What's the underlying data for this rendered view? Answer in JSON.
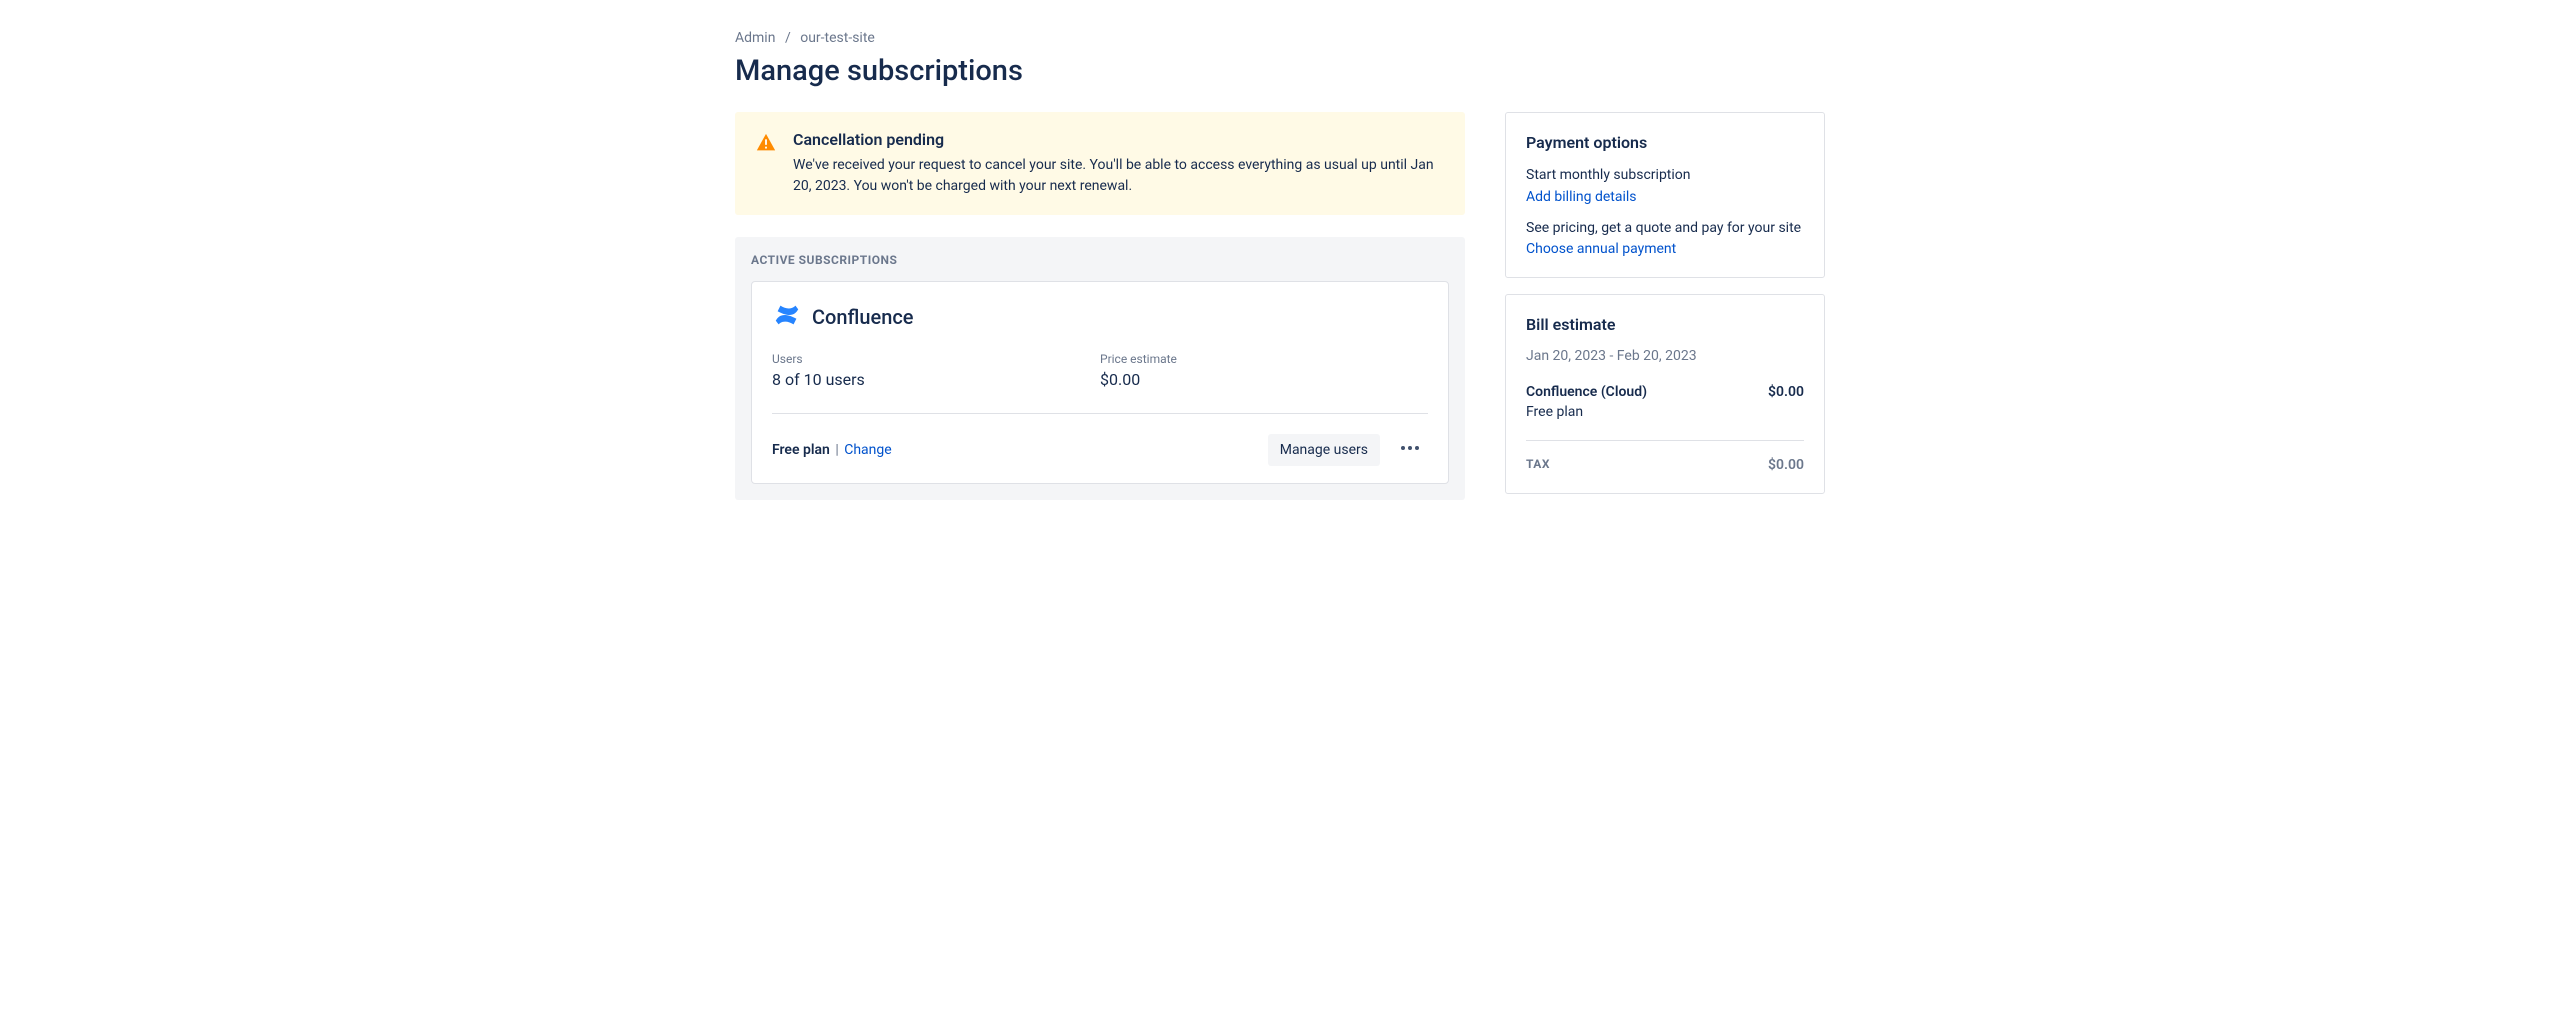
{
  "breadcrumb": {
    "admin": "Admin",
    "site": "our-test-site"
  },
  "page_title": "Manage subscriptions",
  "banner": {
    "title": "Cancellation pending",
    "body": "We've received your request to cancel your site. You'll be able to access everything as usual up until Jan 20, 2023. You won't be charged with your next renewal."
  },
  "active_subscriptions": {
    "header": "ACTIVE SUBSCRIPTIONS",
    "items": [
      {
        "name": "Confluence",
        "users_label": "Users",
        "users_value": "8 of 10 users",
        "price_label": "Price estimate",
        "price_value": "$0.00",
        "plan_name": "Free plan",
        "change_label": "Change",
        "manage_users_label": "Manage users"
      }
    ]
  },
  "payment_options": {
    "title": "Payment options",
    "monthly_text": "Start monthly subscription",
    "monthly_link": "Add billing details",
    "annual_text": "See pricing, get a quote and pay for your site",
    "annual_link": "Choose annual payment"
  },
  "bill_estimate": {
    "title": "Bill estimate",
    "period": "Jan 20, 2023 - Feb 20, 2023",
    "line_item_name": "Confluence (Cloud)",
    "line_item_value": "$0.00",
    "line_item_plan": "Free plan",
    "tax_label": "TAX",
    "tax_value": "$0.00"
  }
}
